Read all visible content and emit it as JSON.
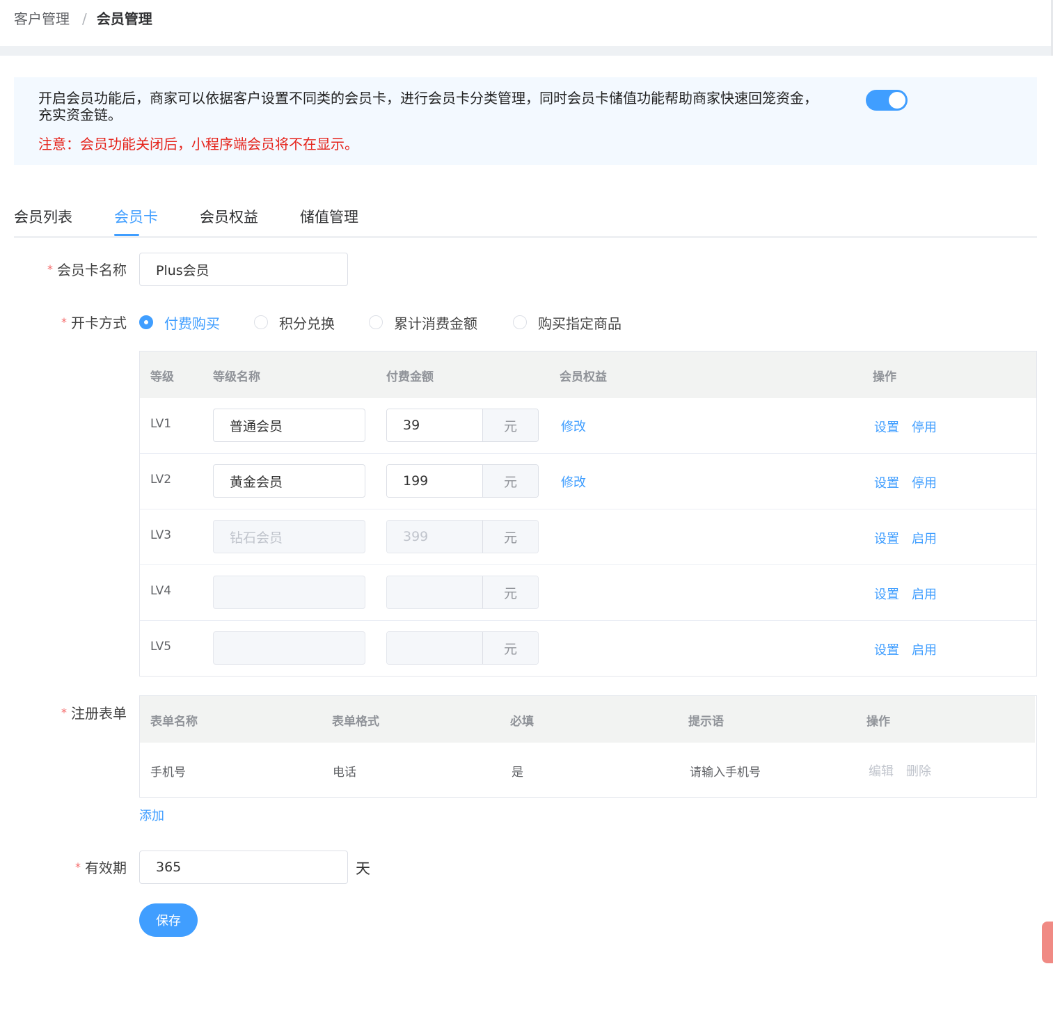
{
  "breadcrumb": {
    "parent": "客户管理",
    "separator": "/",
    "current": "会员管理"
  },
  "notice": {
    "text": "开启会员功能后，商家可以依据客户设置不同类的会员卡，进行会员卡分类管理，同时会员卡储值功能帮助商家快速回笼资金，充实资金链。",
    "warning": "注意：会员功能关闭后，小程序端会员将不在显示。",
    "switch_on": true
  },
  "tabs": [
    "会员列表",
    "会员卡",
    "会员权益",
    "储值管理"
  ],
  "active_tab": "会员卡",
  "form": {
    "card_name_label": "会员卡名称",
    "card_name_value": "Plus会员",
    "open_method_label": "开卡方式",
    "open_methods": [
      "付费购买",
      "积分兑换",
      "累计消费金额",
      "购买指定商品"
    ],
    "selected_method": "付费购买",
    "register_form_label": "注册表单",
    "validity_label": "有效期",
    "validity_value": "365",
    "validity_unit": "天",
    "add_label": "添加",
    "save_label": "保存"
  },
  "level_table": {
    "headers": [
      "等级",
      "等级名称",
      "付费金额",
      "会员权益",
      "操作"
    ],
    "unit": "元",
    "rows": [
      {
        "level": "LV1",
        "name": "普通会员",
        "amount": "39",
        "benefit_link": "修改",
        "set": "设置",
        "toggle": "停用",
        "enabled": true
      },
      {
        "level": "LV2",
        "name": "黄金会员",
        "amount": "199",
        "benefit_link": "修改",
        "set": "设置",
        "toggle": "停用",
        "enabled": true
      },
      {
        "level": "LV3",
        "name": "钻石会员",
        "amount": "399",
        "benefit_link": "",
        "set": "设置",
        "toggle": "启用",
        "enabled": false
      },
      {
        "level": "LV4",
        "name": "",
        "amount": "",
        "benefit_link": "",
        "set": "设置",
        "toggle": "启用",
        "enabled": false
      },
      {
        "level": "LV5",
        "name": "",
        "amount": "",
        "benefit_link": "",
        "set": "设置",
        "toggle": "启用",
        "enabled": false
      }
    ]
  },
  "register_table": {
    "headers": [
      "表单名称",
      "表单格式",
      "必填",
      "提示语",
      "操作"
    ],
    "rows": [
      {
        "name": "手机号",
        "format": "电话",
        "required": "是",
        "hint": "请输入手机号",
        "edit": "编辑",
        "delete": "删除"
      }
    ]
  },
  "colors": {
    "primary": "#409eff",
    "danger": "#e5231b",
    "notice_bg": "#f3f9ff"
  }
}
